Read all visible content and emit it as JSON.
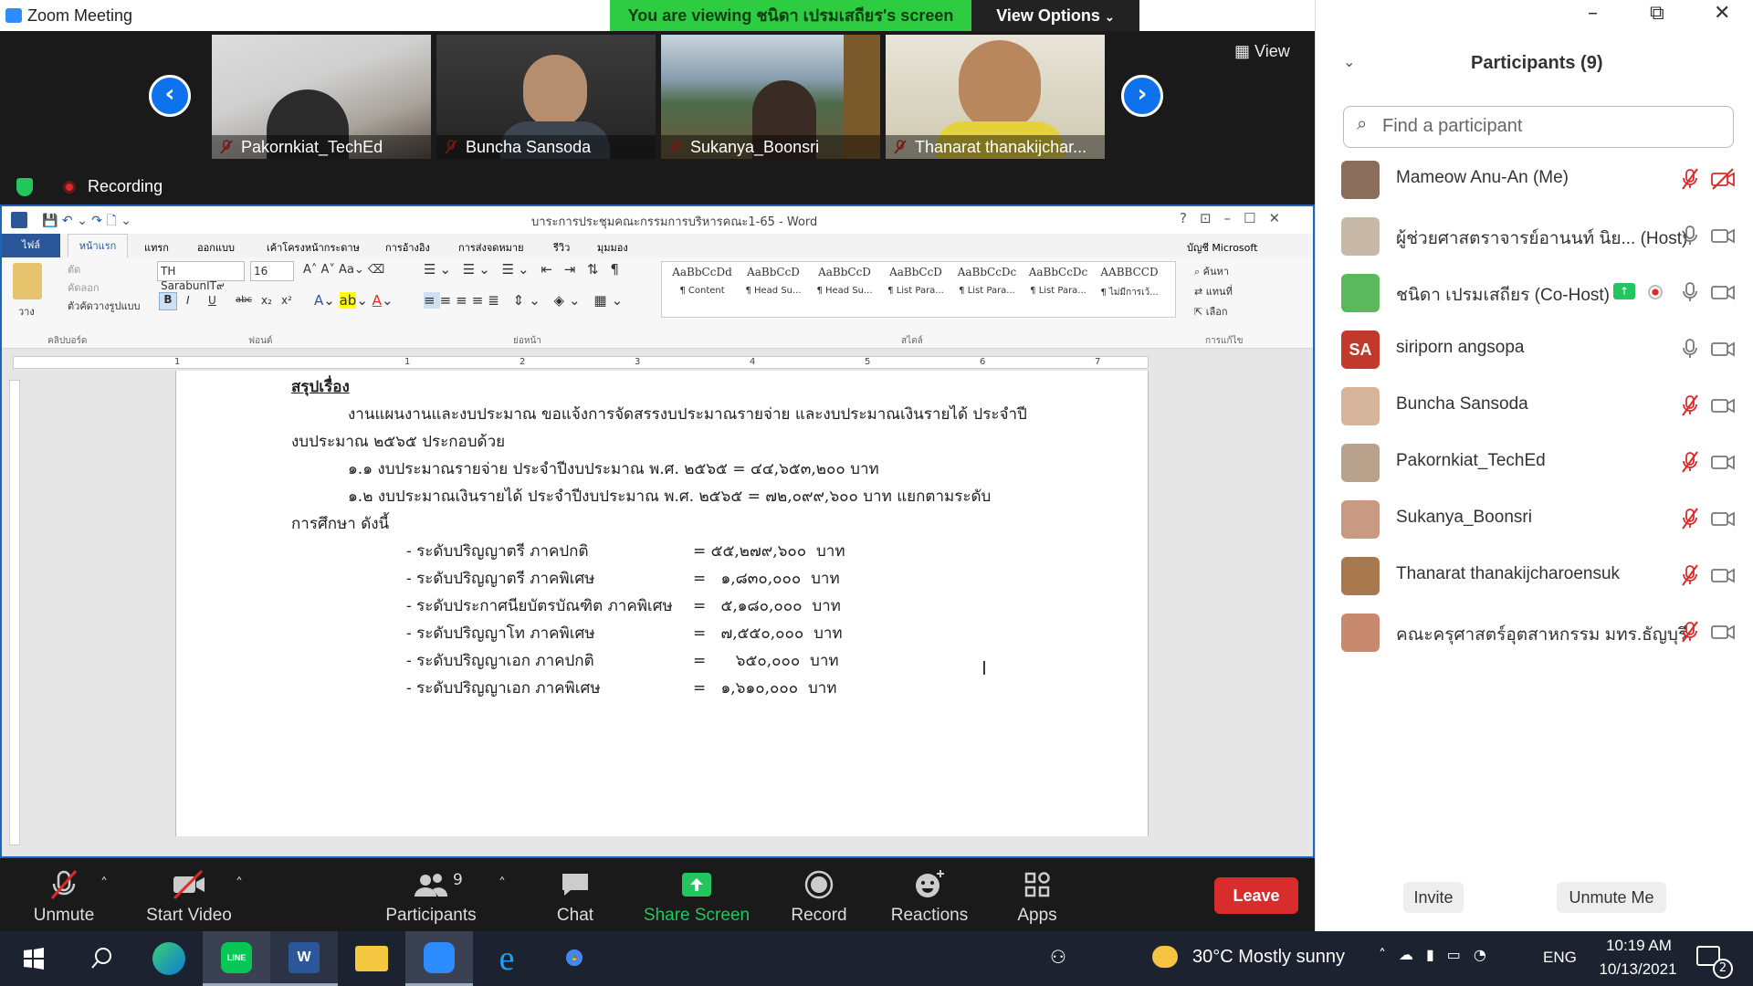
{
  "window": {
    "title": "Zoom Meeting",
    "viewing_banner": "You are viewing ชนิดา เปรมเสถียร's screen",
    "view_options": "View Options"
  },
  "strip": {
    "view_label": "View",
    "recording_label": "Recording",
    "thumbnails": [
      {
        "name": "Pakornkiat_TechEd"
      },
      {
        "name": "Buncha Sansoda"
      },
      {
        "name": "Sukanya_Boonsri"
      },
      {
        "name": "Thanarat thanakijchar..."
      }
    ]
  },
  "word": {
    "doc_title": "บาระการประชุมคณะกรรมการบริหารคณะ1-65 - Word",
    "account": "บัญชี Microsoft",
    "tabs": [
      "ไฟล์",
      "หน้าแรก",
      "แทรก",
      "ออกแบบ",
      "เค้าโครงหน้ากระดาษ",
      "การอ้างอิง",
      "การส่งจดหมาย",
      "รีวิว",
      "มุมมอง"
    ],
    "clipboard": {
      "cut": "ตัด",
      "copy": "คัดลอก",
      "format_painter": "ตัวคัดวางรูปแบบ",
      "paste": "วาง",
      "group": "คลิปบอร์ด"
    },
    "font": {
      "name": "TH SarabunIT๙",
      "size": "16",
      "group": "ฟอนต์",
      "bold": "B",
      "italic": "I",
      "underline": "U",
      "strike": "abc",
      "sub": "x₂",
      "sup": "x²"
    },
    "paragraph_group": "ย่อหน้า",
    "styles_group": "สไตล์",
    "styles": [
      {
        "preview": "AaBbCcDd",
        "label": "¶ Content"
      },
      {
        "preview": "AaBbCcD",
        "label": "¶ Head Su..."
      },
      {
        "preview": "AaBbCcD",
        "label": "¶ Head Su..."
      },
      {
        "preview": "AaBbCcD",
        "label": "¶ List Para..."
      },
      {
        "preview": "AaBbCcDc",
        "label": "¶ List Para..."
      },
      {
        "preview": "AaBbCcDc",
        "label": "¶ List Para..."
      },
      {
        "preview": "AABBCCD",
        "label": "¶ ไม่มีการเว้..."
      }
    ],
    "editing": {
      "find": "ค้นหา",
      "replace": "แทนที่",
      "select": "เลือก",
      "group": "การแก้ไข"
    },
    "ruler_numbers": [
      "1",
      "1",
      "2",
      "3",
      "4",
      "5",
      "6",
      "7"
    ],
    "document": {
      "heading": "สรุปเรื่อง",
      "p1": "งานแผนงานและงบประมาณ ขอแจ้งการจัดสรรงบประมาณรายจ่าย และงบประมาณเงินรายได้ ประจำปี",
      "p1b": "งบประมาณ ๒๕๖๕ ประกอบด้วย",
      "p2": "๑.๑  งบประมาณรายจ่าย ประจำปีงบประมาณ พ.ศ. ๒๕๖๕  = ๔๔,๖๕๓,๒๐๐ บาท",
      "p3": "๑.๒  งบประมาณเงินรายได้ ประจำปีงบประมาณ พ.ศ. ๒๕๖๕ = ๗๒,๐๙๙,๖๐๐ บาท แยกตามระดับ",
      "p3b": "การศึกษา ดังนี้",
      "items": [
        {
          "label": "-  ระดับปริญญาตรี ภาคปกติ",
          "amount": "= ๕๕,๒๗๙,๖๐๐  บาท"
        },
        {
          "label": "-  ระดับปริญญาตรี ภาคพิเศษ",
          "amount": "=   ๑,๘๓๐,๐๐๐  บาท"
        },
        {
          "label": "-  ระดับประกาศนียบัตรบัณฑิต ภาคพิเศษ",
          "amount": "=   ๕,๑๘๐,๐๐๐  บาท"
        },
        {
          "label": "-  ระดับปริญญาโท ภาคพิเศษ",
          "amount": "=   ๗,๕๕๐,๐๐๐  บาท"
        },
        {
          "label": "-  ระดับปริญญาเอก ภาคปกติ",
          "amount": "=      ๖๕๐,๐๐๐  บาท"
        },
        {
          "label": "-  ระดับปริญญาเอก ภาคพิเศษ",
          "amount": "=   ๑,๖๑๐,๐๐๐  บาท"
        }
      ]
    }
  },
  "toolbar": {
    "unmute": "Unmute",
    "start_video": "Start Video",
    "participants": "Participants",
    "participants_count": "9",
    "chat": "Chat",
    "share_screen": "Share Screen",
    "record": "Record",
    "reactions": "Reactions",
    "apps": "Apps",
    "leave": "Leave"
  },
  "panel": {
    "title": "Participants (9)",
    "search_placeholder": "Find a participant",
    "participants": [
      {
        "name": "Mameow Anu-An (Me)",
        "avatar": "",
        "mic": "muted",
        "cam": "off"
      },
      {
        "name": "ผู้ช่วยศาสตราจารย์อานนท์ นิย...  (Host)",
        "avatar": "",
        "mic": "on",
        "cam": "on"
      },
      {
        "name": "ชนิดา เปรมเสถียร (Co-Host)",
        "avatar": "",
        "mic": "on",
        "cam": "on",
        "sharing": true
      },
      {
        "name": "siriporn angsopa",
        "avatar": "SA",
        "mic": "on",
        "cam": "on"
      },
      {
        "name": "Buncha Sansoda",
        "avatar": "",
        "mic": "muted",
        "cam": "on"
      },
      {
        "name": "Pakornkiat_TechEd",
        "avatar": "",
        "mic": "muted",
        "cam": "on"
      },
      {
        "name": "Sukanya_Boonsri",
        "avatar": "",
        "mic": "muted",
        "cam": "on"
      },
      {
        "name": "Thanarat thanakijcharoensuk",
        "avatar": "",
        "mic": "muted",
        "cam": "on"
      },
      {
        "name": "คณะครุศาสตร์อุตสาหกรรม มทร.ธัญบุรี",
        "avatar": "",
        "mic": "muted",
        "cam": "on"
      }
    ],
    "invite": "Invite",
    "unmute_me": "Unmute Me"
  },
  "taskbar": {
    "weather": "30°C  Mostly sunny",
    "lang": "ENG",
    "time": "10:19 AM",
    "date": "10/13/2021",
    "notif_count": "2"
  },
  "colors": {
    "zoom_blue": "#0e72ed",
    "banner_green": "#2ecc40",
    "leave_red": "#d92c2c",
    "share_green": "#22c55e",
    "mute_red": "#e02828",
    "word_blue": "#2b579a"
  }
}
